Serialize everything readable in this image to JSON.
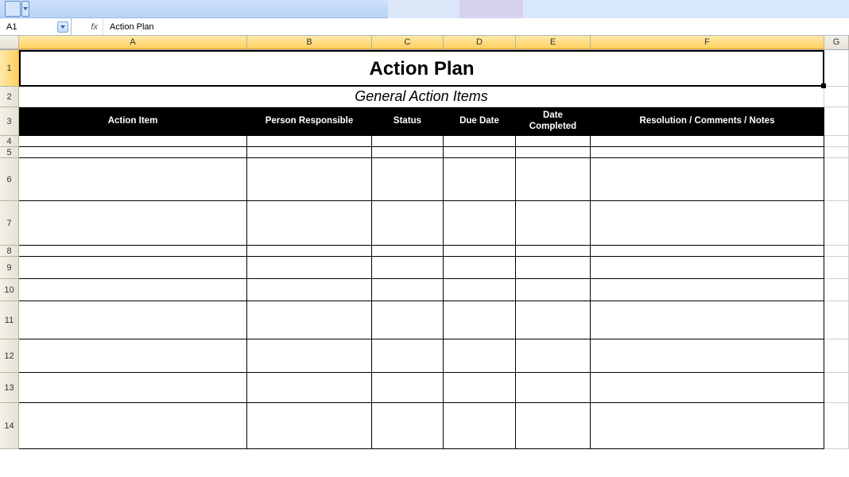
{
  "toolbar": {},
  "name_box": {
    "value": "A1"
  },
  "formula": {
    "fx_label": "fx",
    "value": "Action Plan"
  },
  "columns": {
    "A": "A",
    "B": "B",
    "C": "C",
    "D": "D",
    "E": "E",
    "F": "F",
    "G": "G"
  },
  "rows": {
    "r1": "1",
    "r2": "2",
    "r3": "3",
    "r4": "4",
    "r5": "5",
    "r6": "6",
    "r7": "7",
    "r8": "8",
    "r9": "9",
    "r10": "10",
    "r11": "11",
    "r12": "12",
    "r13": "13",
    "r14": "14"
  },
  "sheet": {
    "title": "Action Plan",
    "subtitle": "General Action Items",
    "headers": {
      "action_item": "Action Item",
      "person_responsible": "Person Responsible",
      "status": "Status",
      "due_date": "Due Date",
      "date_completed": "Date Completed",
      "resolution": "Resolution / Comments / Notes"
    }
  }
}
